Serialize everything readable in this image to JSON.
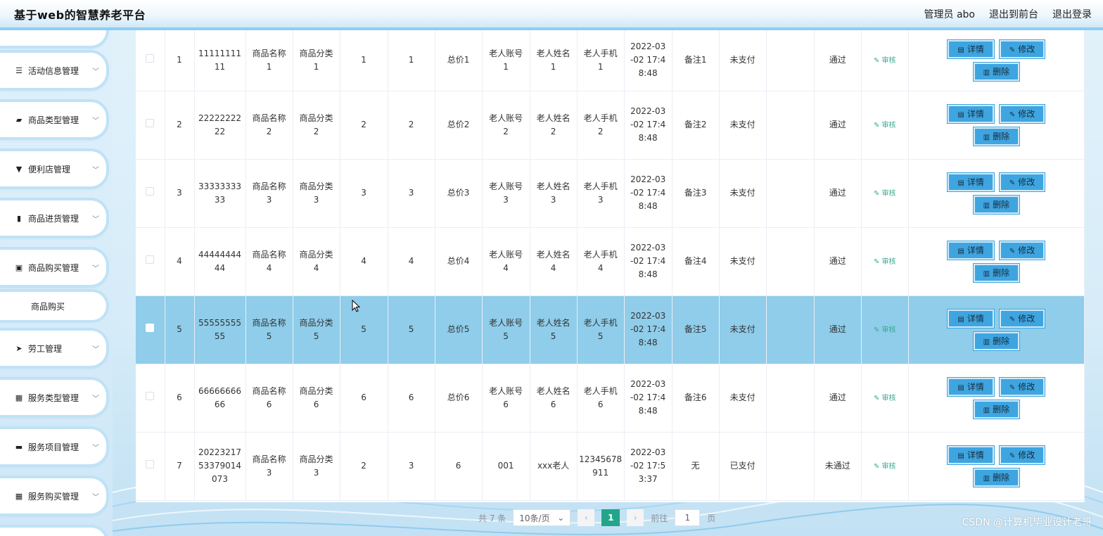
{
  "header": {
    "title": "基于web的智慧养老平台",
    "admin": "管理员 abo",
    "front": "退出到前台",
    "logout": "退出登录"
  },
  "sidebar": {
    "items": [
      {
        "label": "活动信息管理",
        "icon": "sliders-icon"
      },
      {
        "label": "商品类型管理",
        "icon": "tag-icon"
      },
      {
        "label": "便利店管理",
        "icon": "store-icon"
      },
      {
        "label": "商品进货管理",
        "icon": "chart-icon"
      },
      {
        "label": "商品购买管理",
        "icon": "clipboard-icon"
      },
      {
        "label": "劳工管理",
        "icon": "send-icon"
      },
      {
        "label": "服务类型管理",
        "icon": "grid-icon"
      },
      {
        "label": "服务项目管理",
        "icon": "monitor-icon"
      },
      {
        "label": "服务购买管理",
        "icon": "grid-icon"
      }
    ],
    "subitem": "商品购买"
  },
  "table": {
    "rows": [
      {
        "no": "1",
        "order": [
          "11111111",
          "11"
        ],
        "name": [
          "商品名称",
          "1"
        ],
        "category": [
          "商品分类",
          "1"
        ],
        "c4": "1",
        "c5": "1",
        "total": "总价1",
        "account": [
          "老人账号",
          "1"
        ],
        "elder": [
          "老人姓名",
          "1"
        ],
        "phone": [
          "老人手机",
          "1"
        ],
        "time": [
          "2022-03",
          "-02 17:4",
          "8:48"
        ],
        "remark": "备注1",
        "pay": "未支付",
        "empty": "",
        "status": "通过",
        "audit": "审核",
        "selected": false
      },
      {
        "no": "2",
        "order": [
          "22222222",
          "22"
        ],
        "name": [
          "商品名称",
          "2"
        ],
        "category": [
          "商品分类",
          "2"
        ],
        "c4": "2",
        "c5": "2",
        "total": "总价2",
        "account": [
          "老人账号",
          "2"
        ],
        "elder": [
          "老人姓名",
          "2"
        ],
        "phone": [
          "老人手机",
          "2"
        ],
        "time": [
          "2022-03",
          "-02 17:4",
          "8:48"
        ],
        "remark": "备注2",
        "pay": "未支付",
        "empty": "",
        "status": "通过",
        "audit": "审核",
        "selected": false
      },
      {
        "no": "3",
        "order": [
          "33333333",
          "33"
        ],
        "name": [
          "商品名称",
          "3"
        ],
        "category": [
          "商品分类",
          "3"
        ],
        "c4": "3",
        "c5": "3",
        "total": "总价3",
        "account": [
          "老人账号",
          "3"
        ],
        "elder": [
          "老人姓名",
          "3"
        ],
        "phone": [
          "老人手机",
          "3"
        ],
        "time": [
          "2022-03",
          "-02 17:4",
          "8:48"
        ],
        "remark": "备注3",
        "pay": "未支付",
        "empty": "",
        "status": "通过",
        "audit": "审核",
        "selected": false
      },
      {
        "no": "4",
        "order": [
          "44444444",
          "44"
        ],
        "name": [
          "商品名称",
          "4"
        ],
        "category": [
          "商品分类",
          "4"
        ],
        "c4": "4",
        "c5": "4",
        "total": "总价4",
        "account": [
          "老人账号",
          "4"
        ],
        "elder": [
          "老人姓名",
          "4"
        ],
        "phone": [
          "老人手机",
          "4"
        ],
        "time": [
          "2022-03",
          "-02 17:4",
          "8:48"
        ],
        "remark": "备注4",
        "pay": "未支付",
        "empty": "",
        "status": "通过",
        "audit": "审核",
        "selected": false
      },
      {
        "no": "5",
        "order": [
          "55555555",
          "55"
        ],
        "name": [
          "商品名称",
          "5"
        ],
        "category": [
          "商品分类",
          "5"
        ],
        "c4": "5",
        "c5": "5",
        "total": "总价5",
        "account": [
          "老人账号",
          "5"
        ],
        "elder": [
          "老人姓名",
          "5"
        ],
        "phone": [
          "老人手机",
          "5"
        ],
        "time": [
          "2022-03",
          "-02 17:4",
          "8:48"
        ],
        "remark": "备注5",
        "pay": "未支付",
        "empty": "",
        "status": "通过",
        "audit": "审核",
        "selected": true
      },
      {
        "no": "6",
        "order": [
          "66666666",
          "66"
        ],
        "name": [
          "商品名称",
          "6"
        ],
        "category": [
          "商品分类",
          "6"
        ],
        "c4": "6",
        "c5": "6",
        "total": "总价6",
        "account": [
          "老人账号",
          "6"
        ],
        "elder": [
          "老人姓名",
          "6"
        ],
        "phone": [
          "老人手机",
          "6"
        ],
        "time": [
          "2022-03",
          "-02 17:4",
          "8:48"
        ],
        "remark": "备注6",
        "pay": "未支付",
        "empty": "",
        "status": "通过",
        "audit": "审核",
        "selected": false
      },
      {
        "no": "7",
        "order": [
          "20223217",
          "53379014",
          "073"
        ],
        "name": [
          "商品名称",
          "3"
        ],
        "category": [
          "商品分类",
          "3"
        ],
        "c4": "2",
        "c5": "3",
        "total": "6",
        "account": [
          "001"
        ],
        "elder": [
          "xxx老人"
        ],
        "phone": [
          "12345678",
          "911"
        ],
        "time": [
          "2022-03",
          "-02 17:5",
          "3:37"
        ],
        "remark": "无",
        "pay": "已支付",
        "empty": "",
        "status": "未通过",
        "audit": "审核",
        "selected": false
      }
    ],
    "buttons": {
      "detail": "详情",
      "edit": "修改",
      "delete": "删除"
    }
  },
  "pagination": {
    "total": "共 7 条",
    "page_size": "10条/页",
    "current": "1",
    "goto_prefix": "前往",
    "goto_value": "1",
    "goto_suffix": "页"
  },
  "watermark": "CSDN @计算机毕业设计老哥",
  "colors": {
    "accent": "#3ea5e0",
    "selected_row": "#8fcdea",
    "audit": "#3aa88e",
    "active_page": "#22a58b"
  }
}
